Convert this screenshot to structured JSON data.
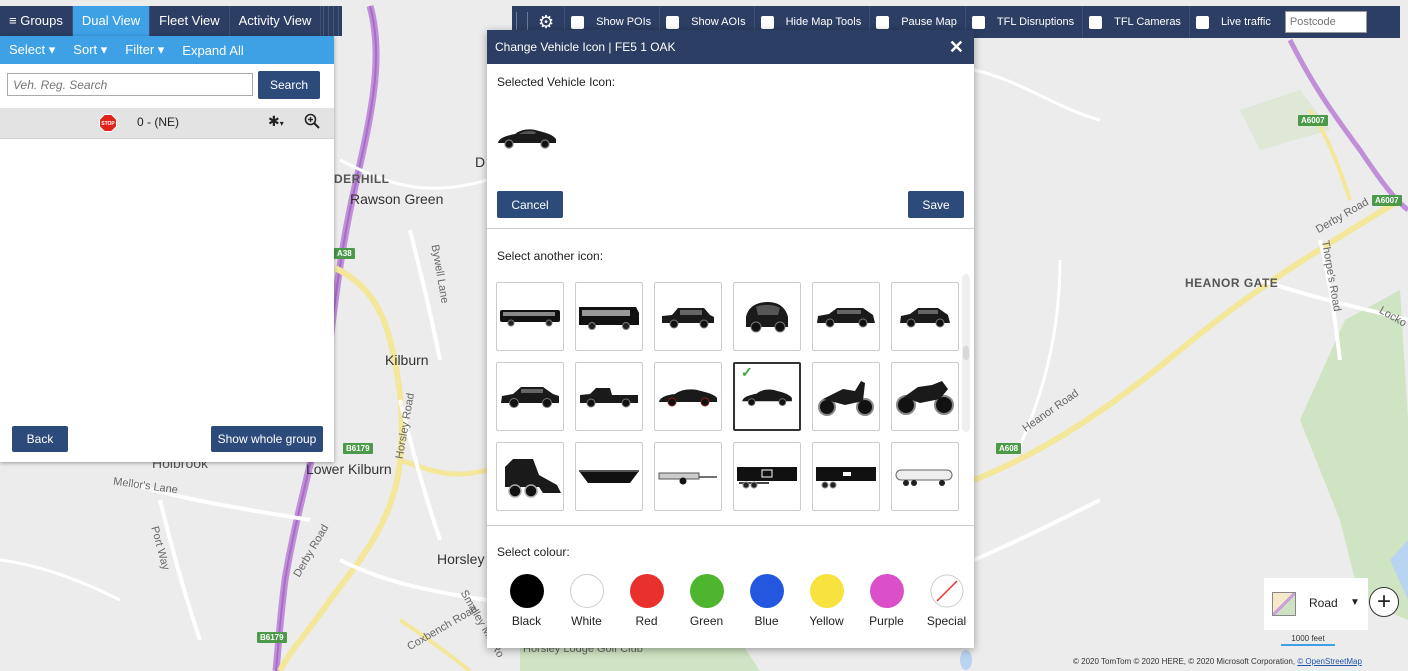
{
  "left_tabs": {
    "groups": "Groups",
    "dual_view": "Dual View",
    "fleet_view": "Fleet View",
    "activity_view": "Activity View"
  },
  "left_toolbar": {
    "select": "Select ▾",
    "sort": "Sort ▾",
    "filter": "Filter ▾",
    "expand_all": "Expand All"
  },
  "search": {
    "placeholder": "Veh. Reg. Search",
    "button": "Search"
  },
  "vehicle_row": {
    "label": "0 - (NE)",
    "stop_badge": "STOP"
  },
  "left_buttons": {
    "back": "Back",
    "show_whole_group": "Show whole group"
  },
  "top_toolbar": {
    "show_pois": "Show POIs",
    "show_aois": "Show AOIs",
    "hide_map_tools": "Hide Map Tools",
    "pause_map": "Pause Map",
    "tfl_disruptions": "TFL Disruptions",
    "tfl_cameras": "TFL Cameras",
    "live_traffic": "Live traffic",
    "postcode_placeholder": "Postcode"
  },
  "modal": {
    "title": "Change Vehicle Icon | FE5 1 OAK",
    "close": "✕",
    "selected_label": "Selected Vehicle Icon:",
    "cancel": "Cancel",
    "save": "Save",
    "select_another": "Select another icon:",
    "select_colour": "Select colour:",
    "icons": [
      "bus-icon",
      "coach-icon",
      "suv-icon",
      "smart-car-icon",
      "estate-car-icon",
      "hatchback-icon",
      "sedan-icon",
      "pickup-truck-icon",
      "saloon-car-icon",
      "sports-car-icon",
      "scooter-icon",
      "motorbike-icon",
      "skid-steer-icon",
      "skip-icon",
      "trailer-icon",
      "flatbed-trailer-icon",
      "box-trailer-icon",
      "tanker-trailer-icon"
    ],
    "selected_index": 9,
    "colours": [
      {
        "name": "Black",
        "hex": "#000000"
      },
      {
        "name": "White",
        "hex": "#ffffff"
      },
      {
        "name": "Red",
        "hex": "#e8302c"
      },
      {
        "name": "Green",
        "hex": "#4db52e"
      },
      {
        "name": "Blue",
        "hex": "#2357e0"
      },
      {
        "name": "Yellow",
        "hex": "#f8e23e"
      },
      {
        "name": "Purple",
        "hex": "#db4fc9"
      },
      {
        "name": "Special",
        "hex": "#ffffff"
      }
    ]
  },
  "map": {
    "labels": {
      "rawson_green": "Rawson Green",
      "kilburn": "Kilburn",
      "lower_kilburn": "Lower Kilburn",
      "horsley": "Horsley",
      "heanor_gate": "HEANOR GATE",
      "derhill": "DERHILL",
      "holbrook": "Holbrook",
      "d": "D",
      "mellors_lane": "Mellor's Lane",
      "port_way": "Port Way",
      "derby_road_1": "Derby Road",
      "derby_road_2": "Derby Road",
      "bywell_lane": "Bywell Lane",
      "horsley_road": "Horsley Road",
      "heanor_road": "Heanor Road",
      "thorpes_road": "Thorpe's Road",
      "locko": "Locko",
      "coxbench_road": "Coxbench Road",
      "smalley_mill": "Smalley Mill Ro",
      "golf_club": "Horsley Lodge Golf Club"
    },
    "badges": {
      "a38": "A38",
      "b6179_1": "B6179",
      "b6179_2": "B6179",
      "a6007_1": "A6007",
      "a6007_2": "A6007",
      "a608": "A608"
    },
    "layer": "Road",
    "scale": "1000 feet",
    "attribution": "© 2020 TomTom © 2020 HERE, © 2020 Microsoft Corporation, ",
    "attribution_link": "© OpenStreetMap"
  }
}
